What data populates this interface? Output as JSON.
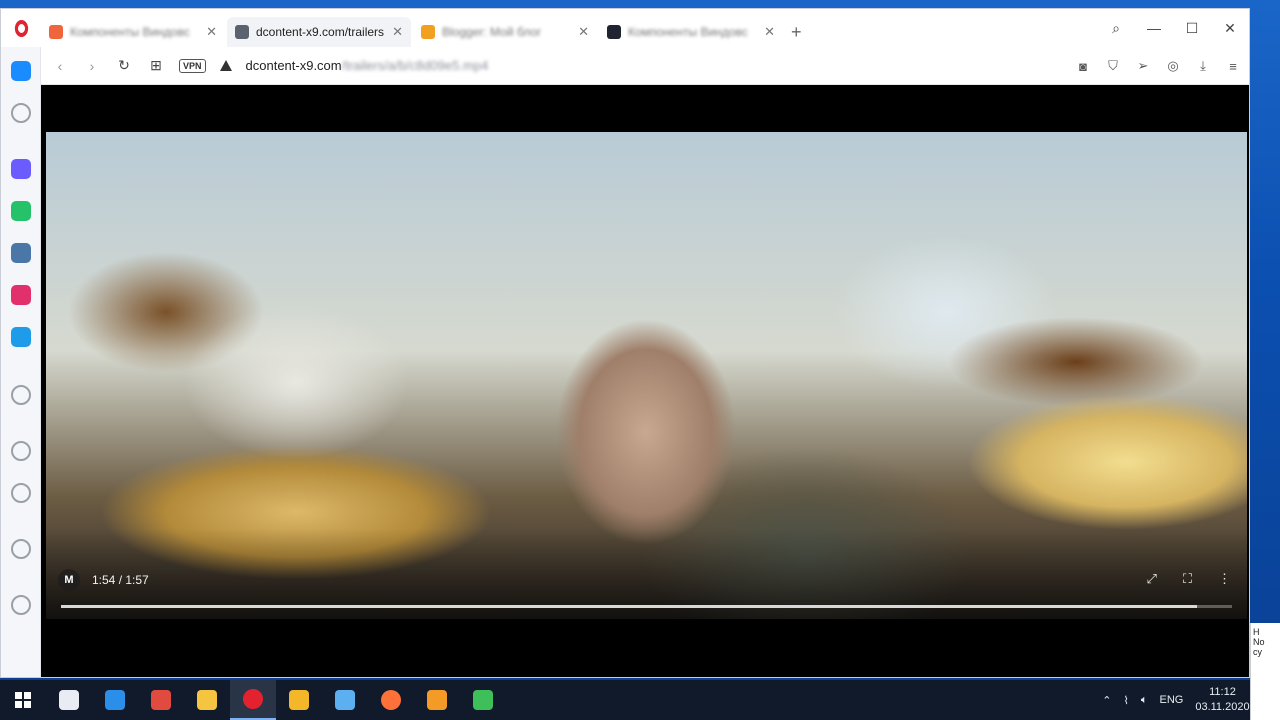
{
  "browser": {
    "tabs": [
      {
        "title": "Компоненты Виндовс",
        "favicon_color": "#f0663c",
        "active": false,
        "blurred": true
      },
      {
        "title": "dcontent-x9.com/trailers",
        "favicon_color": "#5a6270",
        "active": true,
        "blurred": false
      },
      {
        "title": "Blogger: Мой блог",
        "favicon_color": "#f1a020",
        "active": false,
        "blurred": true
      },
      {
        "title": "Компоненты Виндовс",
        "favicon_color": "#1f2430",
        "active": false,
        "blurred": true
      }
    ],
    "new_tab_icon": "plus-icon",
    "window_controls": [
      "search-icon",
      "minimize-icon",
      "maximize-icon",
      "close-icon"
    ],
    "address": {
      "vpn_label": "VPN",
      "url_host": "dcontent-x9.com",
      "url_path": "/trailers/a/b/c8d09e5.mp4"
    }
  },
  "sidebar": {
    "icons": [
      {
        "name": "home",
        "color": "#1a8cff"
      },
      {
        "name": "speed-dial",
        "color": "#9aa0a8"
      },
      {
        "name": "messenger",
        "color": "#6b5cff"
      },
      {
        "name": "whatsapp",
        "color": "#25c26a"
      },
      {
        "name": "vk",
        "color": "#4a76a8"
      },
      {
        "name": "instagram",
        "color": "#e1306c"
      },
      {
        "name": "bookmarks",
        "color": "#1e9be9"
      },
      {
        "name": "send",
        "color": "#9aa0a8"
      },
      {
        "name": "heart",
        "color": "#9aa0a8"
      },
      {
        "name": "history",
        "color": "#9aa0a8"
      },
      {
        "name": "lightbulb",
        "color": "#9aa0a8"
      },
      {
        "name": "more",
        "color": "#9aa0a8"
      }
    ]
  },
  "player": {
    "mute_label": "M",
    "time_text": "1:54 / 1:57",
    "progress_fraction": 0.97,
    "controls": [
      "expand-icon",
      "fullscreen-icon",
      "more-icon"
    ]
  },
  "taskbar": {
    "apps": [
      {
        "name": "task-view",
        "color": "#e9edf3"
      },
      {
        "name": "mail",
        "color": "#2b8ee8"
      },
      {
        "name": "paint",
        "color": "#e04a3f"
      },
      {
        "name": "file-explorer",
        "color": "#f5c542"
      },
      {
        "name": "opera",
        "color": "#e3222f",
        "active": true
      },
      {
        "name": "star-app",
        "color": "#f5b72a"
      },
      {
        "name": "3d-viewer",
        "color": "#5db0f0"
      },
      {
        "name": "firefox",
        "color": "#ff7139"
      },
      {
        "name": "orange-app",
        "color": "#f39a27"
      },
      {
        "name": "sketch-app",
        "color": "#3fbf5a"
      }
    ],
    "tray": {
      "language": "ENG",
      "time": "11:12",
      "date": "03.11.2020"
    }
  },
  "fragment": {
    "line1": "H",
    "line2": "No",
    "line3": "су"
  }
}
